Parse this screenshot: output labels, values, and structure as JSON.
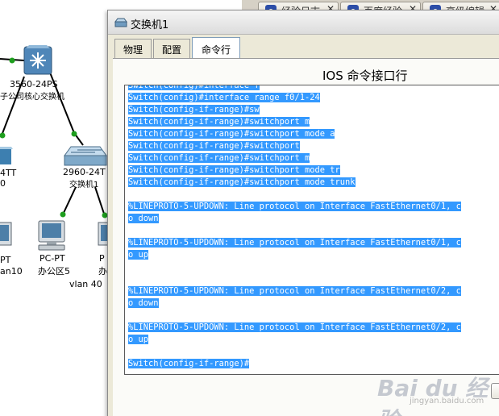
{
  "browser_tabs": [
    {
      "label": "经验日志"
    },
    {
      "label": "百度经验"
    },
    {
      "label": "高级编辑"
    }
  ],
  "topology": {
    "core_switch": {
      "model": "3560-24PS",
      "name": "子公司核心交换机"
    },
    "left_switch": {
      "model": "4TT",
      "name": "0"
    },
    "access_switch": {
      "model": "2960-24T",
      "name": "交换机1"
    },
    "pc_left": {
      "model": "PT",
      "name": "an10"
    },
    "pc_mid": {
      "model": "PC-PT",
      "name": "办公区5"
    },
    "pc_right": {
      "model": "P",
      "name": "办"
    },
    "vlan_label": "vlan 40"
  },
  "window": {
    "title": "交换机1",
    "tabs": [
      {
        "label": "物理",
        "active": false
      },
      {
        "label": "配置",
        "active": false
      },
      {
        "label": "命令行",
        "active": true
      }
    ],
    "cli_heading": "IOS 命令接口行"
  },
  "terminal": {
    "lines": [
      "Switch(config)#interface f",
      "Switch(config)#interface range f0/1-24",
      "Switch(config-if-range)#sw",
      "Switch(config-if-range)#switchport m",
      "Switch(config-if-range)#switchport mode a",
      "Switch(config-if-range)#switchport",
      "Switch(config-if-range)#switchport m",
      "Switch(config-if-range)#switchport mode tr",
      "Switch(config-if-range)#switchport mode trunk",
      "",
      "%LINEPROTO-5-UPDOWN: Line protocol on Interface FastEthernet0/1, c",
      "o down",
      "",
      "%LINEPROTO-5-UPDOWN: Line protocol on Interface FastEthernet0/1, c",
      "o up",
      "",
      "",
      "%LINEPROTO-5-UPDOWN: Line protocol on Interface FastEthernet0/2, c",
      "o down",
      "",
      "%LINEPROTO-5-UPDOWN: Line protocol on Interface FastEthernet0/2, c",
      "o up",
      "",
      "Switch(config-if-range)#"
    ],
    "selection_color": "#3399ff"
  },
  "watermark": {
    "brand": "Bai du 经验",
    "url": "jingyan.baidu.com"
  },
  "icons": {
    "window_icon": "switch-icon",
    "browser_tab_icon": "paw-icon",
    "close": "close-icon"
  }
}
